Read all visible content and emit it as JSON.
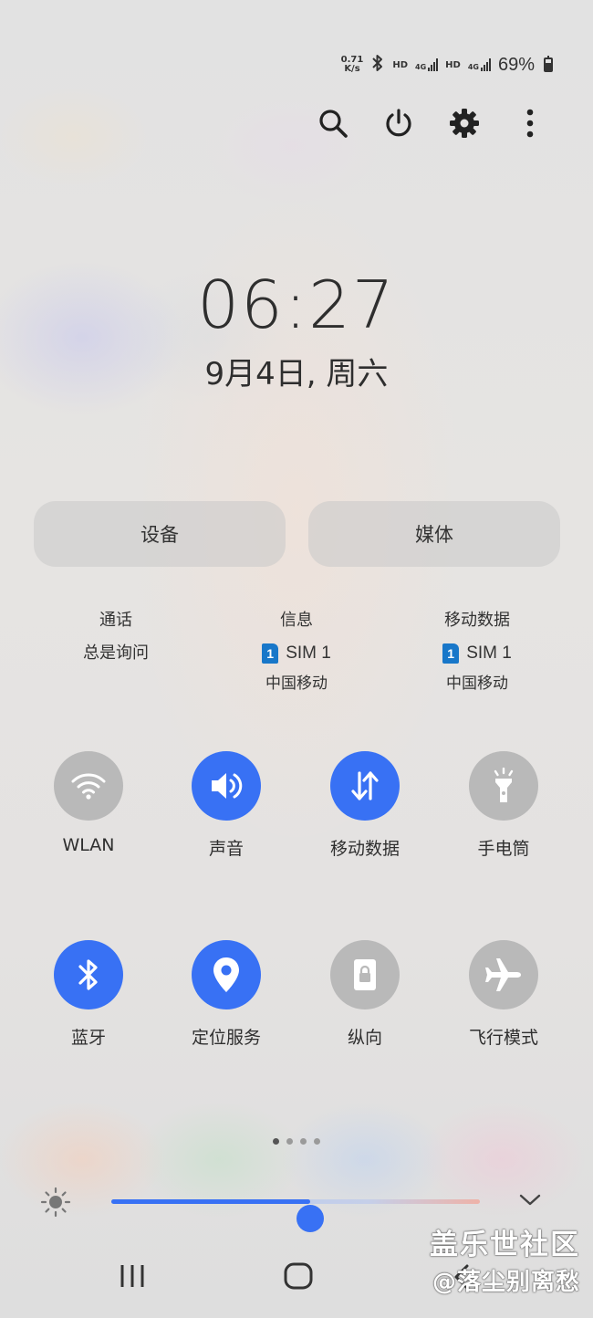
{
  "status_bar": {
    "net_speed_value": "0.71",
    "net_speed_unit": "K/s",
    "hd_1": "HD",
    "net_1": "4G",
    "hd_2": "HD",
    "net_2": "4G",
    "battery_percent": "69%",
    "icons": [
      "bluetooth-icon",
      "signal-icon",
      "battery-charging-icon"
    ]
  },
  "top_actions": {
    "icons": [
      "search-icon",
      "power-icon",
      "settings-icon",
      "more-options-icon"
    ]
  },
  "clock": {
    "hours": "06",
    "separator": ":",
    "minutes": "27",
    "date": "9月4日, 周六"
  },
  "panels": {
    "devices": "设备",
    "media": "媒体"
  },
  "sim_info": [
    {
      "title": "通话",
      "value": "总是询问",
      "operator": ""
    },
    {
      "title": "信息",
      "sim_badge": "1",
      "value": "SIM 1",
      "operator": "中国移动"
    },
    {
      "title": "移动数据",
      "sim_badge": "1",
      "value": "SIM 1",
      "operator": "中国移动"
    }
  ],
  "tiles": [
    {
      "label": "WLAN",
      "icon": "wifi-icon",
      "state": "off"
    },
    {
      "label": "声音",
      "icon": "sound-icon",
      "state": "on"
    },
    {
      "label": "移动数据",
      "icon": "mobile-data-icon",
      "state": "on"
    },
    {
      "label": "手电筒",
      "icon": "flashlight-icon",
      "state": "off"
    },
    {
      "label": "蓝牙",
      "icon": "bluetooth-icon",
      "state": "on"
    },
    {
      "label": "定位服务",
      "icon": "location-icon",
      "state": "on"
    },
    {
      "label": "纵向",
      "icon": "portrait-lock-icon",
      "state": "off"
    },
    {
      "label": "飞行模式",
      "icon": "airplane-icon",
      "state": "off"
    }
  ],
  "pagination": {
    "pages": 4,
    "active": 1
  },
  "brightness": {
    "level": 0.54,
    "icon": "brightness-icon",
    "expand_icon": "chevron-down-icon"
  },
  "nav_bar": {
    "icons": [
      "recent-apps-icon",
      "home-icon",
      "back-icon"
    ]
  },
  "watermark": {
    "brand": "盖乐世社区",
    "user": "@落尘别离愁"
  },
  "colors": {
    "accent": "#3871f4",
    "tile_off": "#b9b9b9",
    "sim_badge": "#1877c9"
  }
}
